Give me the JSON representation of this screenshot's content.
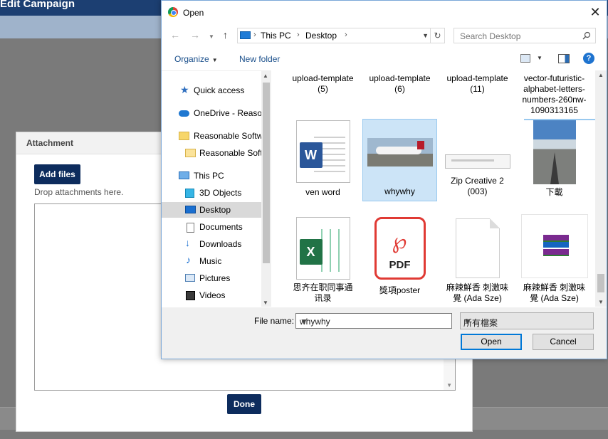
{
  "page": {
    "title": "Edit Campaign"
  },
  "attachment_modal": {
    "title": "Attachment",
    "add_files": "Add files",
    "drop_text": "Drop attachments here.",
    "done": "Done"
  },
  "dialog": {
    "title": "Open",
    "close": "✕",
    "address": [
      "This PC",
      "Desktop"
    ],
    "search_placeholder": "Search Desktop",
    "toolbar": {
      "organize": "Organize",
      "new_folder": "New folder",
      "help": "?"
    },
    "nav": [
      {
        "label": "Quick access",
        "icon": "star-icon"
      },
      {
        "label": "OneDrive - Reasonable Software",
        "icon": "cloud-icon"
      },
      {
        "label": "Reasonable Software",
        "icon": "folder-icon"
      },
      {
        "label": "Reasonable Software",
        "icon": "folder-icon"
      },
      {
        "label": "This PC",
        "icon": "computer-icon"
      },
      {
        "label": "3D Objects",
        "icon": "cube-icon"
      },
      {
        "label": "Desktop",
        "icon": "desktop-icon"
      },
      {
        "label": "Documents",
        "icon": "document-icon"
      },
      {
        "label": "Downloads",
        "icon": "download-icon"
      },
      {
        "label": "Music",
        "icon": "music-icon"
      },
      {
        "label": "Pictures",
        "icon": "pictures-icon"
      },
      {
        "label": "Videos",
        "icon": "video-icon"
      }
    ],
    "files": [
      {
        "name": "upload-template\n(5)"
      },
      {
        "name": "upload-template\n(6)"
      },
      {
        "name": "upload-template\n(11)"
      },
      {
        "name": "vector-futuristic-\nalphabet-letters-\nnumbers-260nw-\n1090313165"
      },
      {
        "name": "ven word"
      },
      {
        "name": "whywhy"
      },
      {
        "name": "Zip Creative 2\n(003)"
      },
      {
        "name": "下載"
      },
      {
        "name": "思齐在职同事通\n讯录"
      },
      {
        "name": "獎項poster"
      },
      {
        "name": "麻辣鮮香 刺激味\n覺 (Ada Sze)"
      },
      {
        "name": "麻辣鮮香 刺激味\n覺 (Ada Sze)"
      }
    ],
    "file_name_label": "File name:",
    "file_name_value": "whywhy",
    "file_type": "所有檔案",
    "open_button": "Open",
    "cancel_button": "Cancel",
    "pdf_label": "PDF",
    "word_letter": "W",
    "excel_letter": "X"
  }
}
